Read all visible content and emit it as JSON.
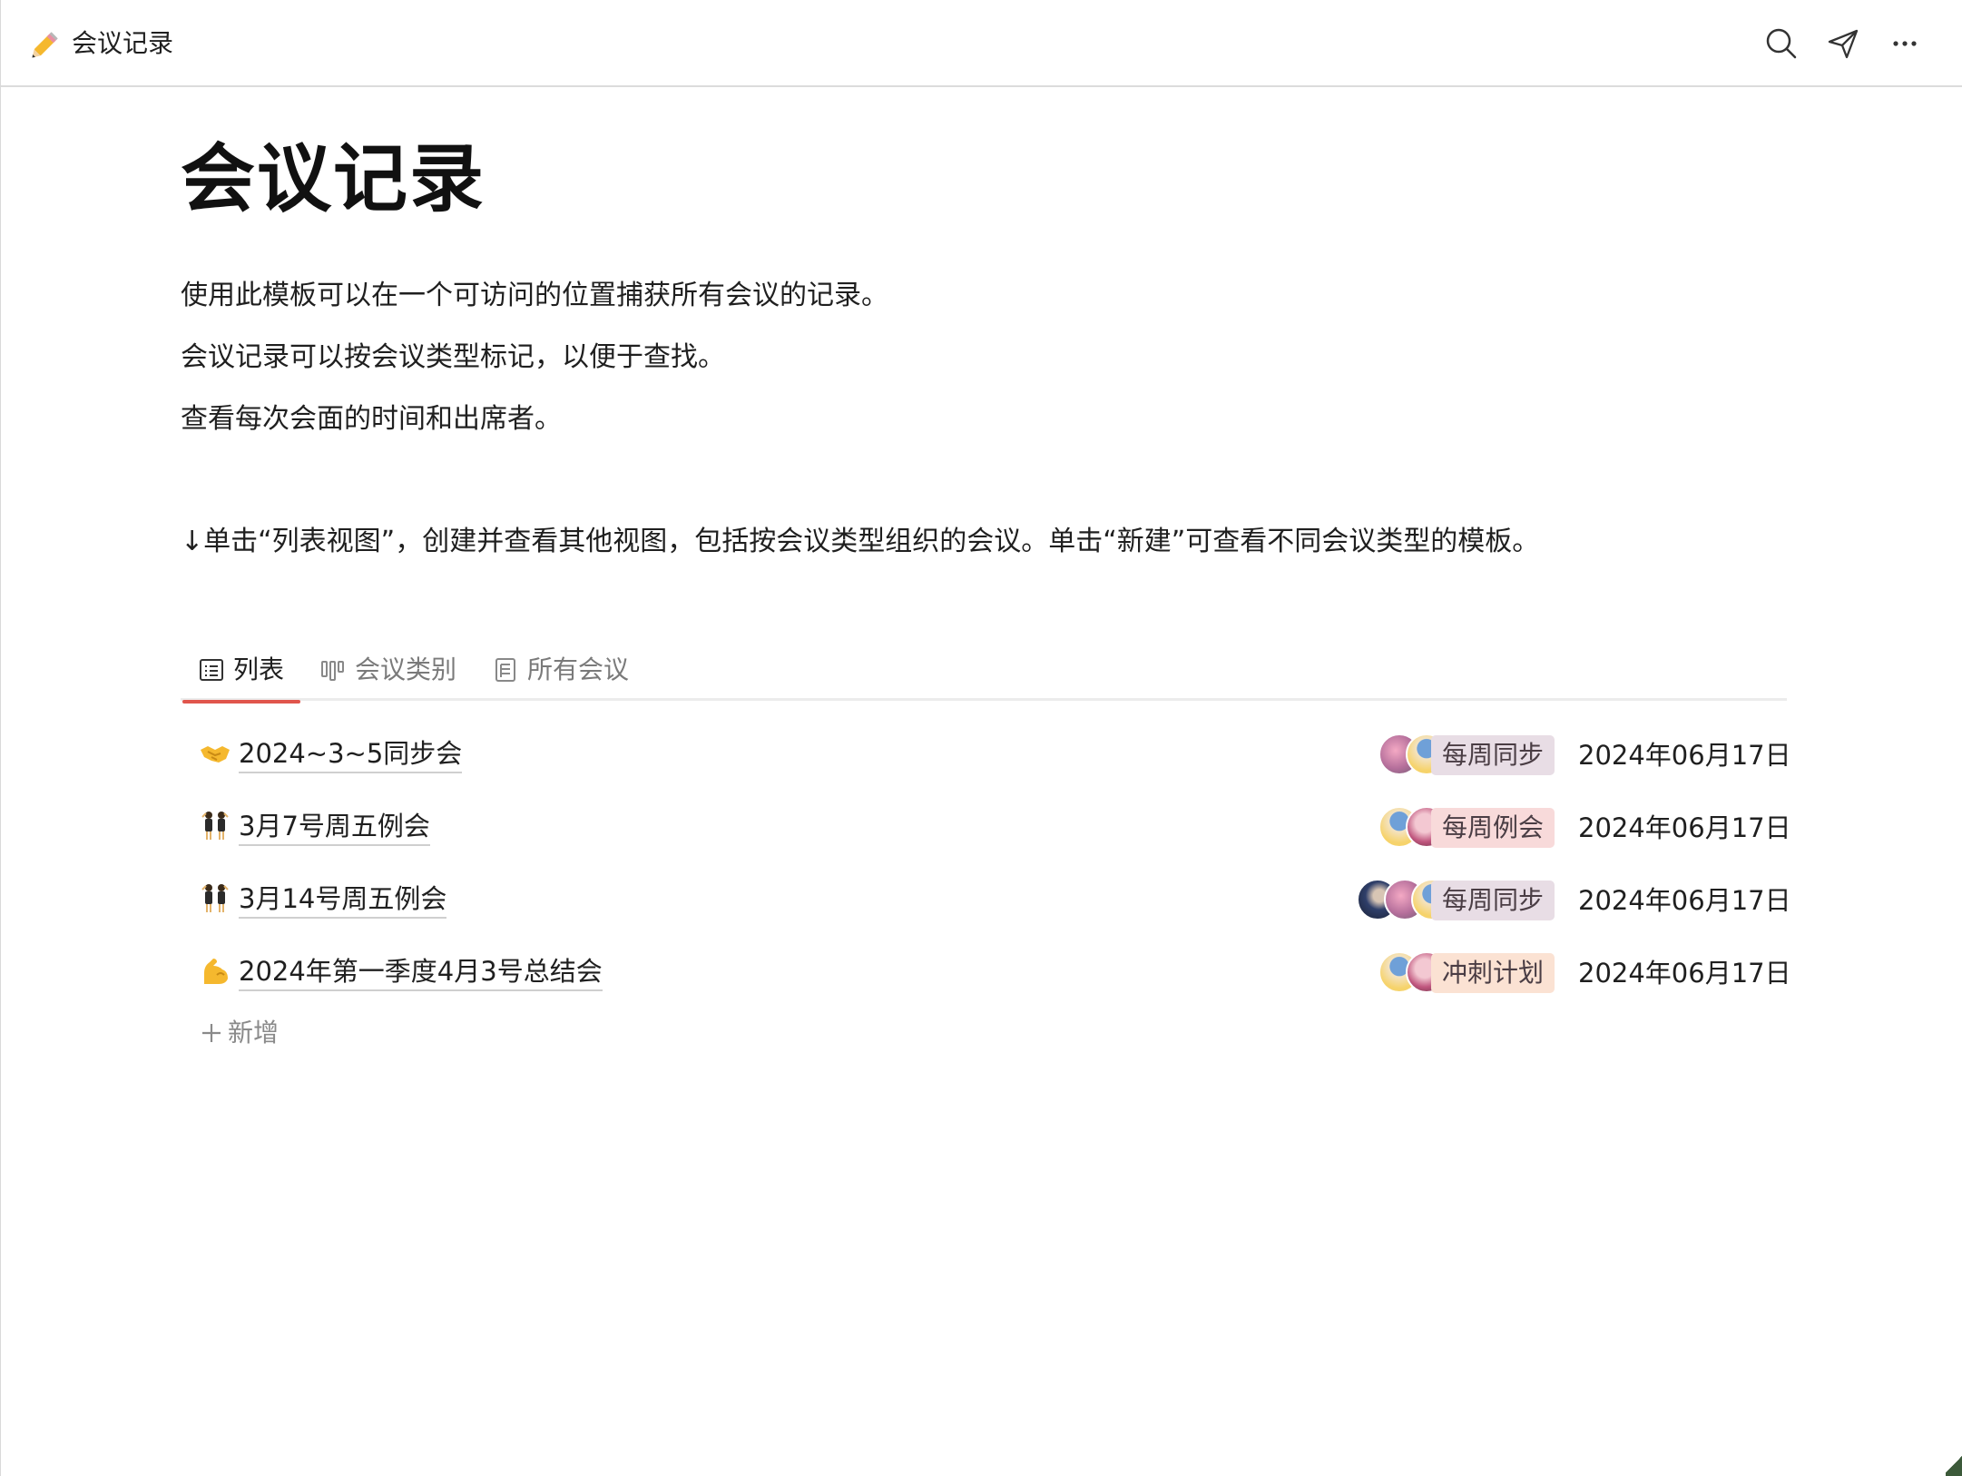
{
  "topbar": {
    "title": "会议记录",
    "doc_icon": "pencil-icon",
    "actions": [
      "search-icon",
      "send-icon",
      "more-icon"
    ]
  },
  "page": {
    "title": "会议记录",
    "paragraphs": [
      "使用此模板可以在一个可访问的位置捕获所有会议的记录。",
      "会议记录可以按会议类型标记，以便于查找。",
      "查看每次会面的时间和出席者。",
      "↓单击“列表视图”，创建并查看其他视图，包括按会议类型组织的会议。单击“新建”可查看不同会议类型的模板。"
    ]
  },
  "tabs": [
    {
      "label": "列表",
      "icon": "list-view-icon",
      "active": true
    },
    {
      "label": "会议类别",
      "icon": "board-view-icon",
      "active": false
    },
    {
      "label": "所有会议",
      "icon": "table-view-icon",
      "active": false
    }
  ],
  "rows": [
    {
      "emoji": "handshake-icon",
      "title": "2024~3~5同步会",
      "attendees": 3,
      "tag": "每周同步",
      "tag_color": "#e8dde5",
      "date": "2024年06月17日"
    },
    {
      "emoji": "dancers-icon",
      "title": "3月7号周五例会",
      "attendees": 3,
      "tag": "每周例会",
      "tag_color": "#f8dada",
      "date": "2024年06月17日"
    },
    {
      "emoji": "dancers-icon",
      "title": "3月14号周五例会",
      "attendees": 4,
      "tag": "每周同步",
      "tag_color": "#e8dde5",
      "date": "2024年06月17日"
    },
    {
      "emoji": "flexed-biceps-icon",
      "title": "2024年第一季度4月3号总结会",
      "attendees": 3,
      "tag": "冲刺计划",
      "tag_color": "#fbe2d3",
      "date": "2024年06月17日"
    }
  ],
  "add_new": {
    "label": "新增",
    "icon": "plus-icon"
  },
  "colors": {
    "accent_underline": "#e0554c",
    "text": "#1f1f1f",
    "muted": "#7a7a7a"
  }
}
